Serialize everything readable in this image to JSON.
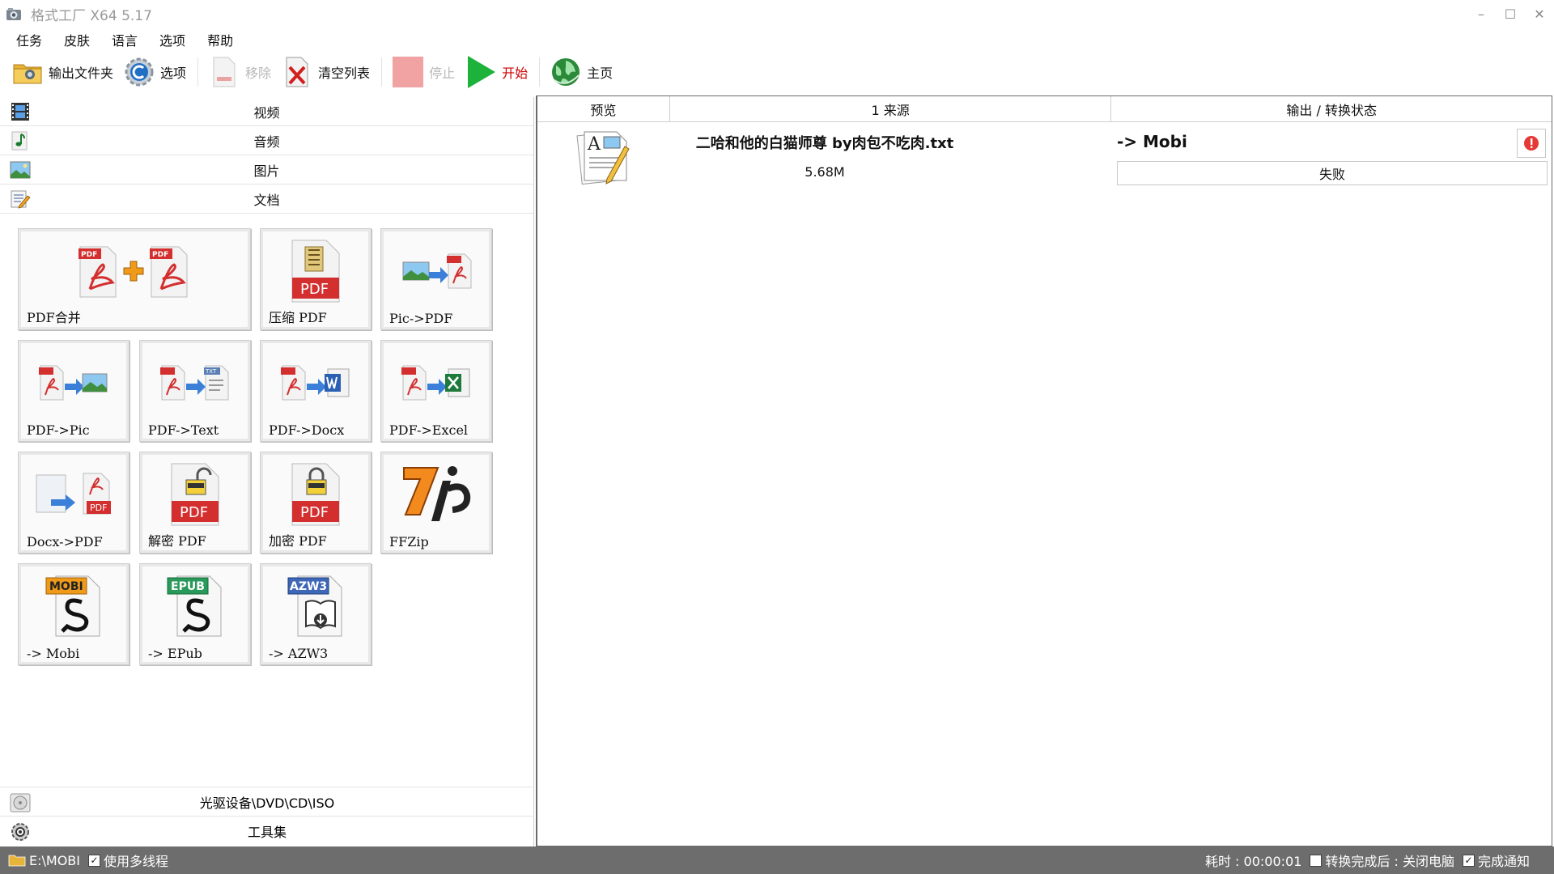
{
  "window": {
    "title": "格式工厂 X64 5.17",
    "controls": {
      "minimize": "–",
      "maximize": "☐",
      "close": "✕"
    }
  },
  "menu": [
    "任务",
    "皮肤",
    "语言",
    "选项",
    "帮助"
  ],
  "toolbar": {
    "output_folder": "输出文件夹",
    "options": "选项",
    "remove": "移除",
    "clear_list": "清空列表",
    "stop": "停止",
    "start": "开始",
    "home": "主页"
  },
  "categories": {
    "video": "视频",
    "audio": "音频",
    "image": "图片",
    "document": "文档",
    "optical": "光驱设备\\DVD\\CD\\ISO",
    "tools": "工具集"
  },
  "tiles": {
    "pdf_merge": "PDF合并",
    "compress_pdf": "压缩 PDF",
    "pic_pdf": "Pic->PDF",
    "pdf_pic": "PDF->Pic",
    "pdf_text": "PDF->Text",
    "pdf_docx": "PDF->Docx",
    "pdf_excel": "PDF->Excel",
    "docx_pdf": "Docx->PDF",
    "decrypt_pdf": "解密 PDF",
    "encrypt_pdf": "加密 PDF",
    "ffzip": "FFZip",
    "to_mobi": "-> Mobi",
    "to_epub": "-> EPub",
    "to_azw3": "-> AZW3"
  },
  "icon_text": {
    "pdf": "PDF",
    "txt": "TXT",
    "mobi": "MOBI",
    "epub": "EPUB",
    "azw3": "AZW3"
  },
  "task_list": {
    "headers": {
      "preview": "预览",
      "source": "1 来源",
      "output": "输出 / 转换状态"
    },
    "rows": [
      {
        "name": "二哈和他的白猫师尊 by肉包不吃肉.txt",
        "size": "5.68M",
        "format": "-> Mobi",
        "status": "失败"
      }
    ]
  },
  "statusbar": {
    "output_path": "E:\\MOBI",
    "multithread_label": "使用多线程",
    "multithread_checked": true,
    "elapsed": "耗时 : 00:00:01",
    "after_complete": "转换完成后 : 关闭电脑",
    "after_complete_checked": false,
    "notify_label": "完成通知",
    "notify_checked": true
  },
  "colors": {
    "pdf_red": "#d32f2f",
    "start_green": "#1db33a",
    "statusbar_bg": "#6d6d6d",
    "error_red": "#e53935"
  }
}
